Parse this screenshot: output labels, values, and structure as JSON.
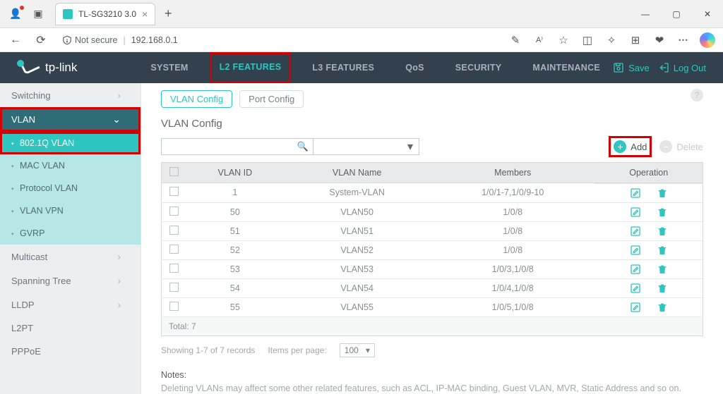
{
  "browser": {
    "tab_title": "TL-SG3210 3.0",
    "url": "192.168.0.1",
    "not_secure": "Not secure"
  },
  "header": {
    "brand": "tp-link",
    "nav": [
      "SYSTEM",
      "L2 FEATURES",
      "L3 FEATURES",
      "QoS",
      "SECURITY",
      "MAINTENANCE"
    ],
    "active_nav_index": 1,
    "save": "Save",
    "logout": "Log Out"
  },
  "sidebar": {
    "items": [
      {
        "label": "Switching",
        "type": "group"
      },
      {
        "label": "VLAN",
        "type": "group-expanded",
        "children": [
          "802.1Q VLAN",
          "MAC VLAN",
          "Protocol VLAN",
          "VLAN VPN",
          "GVRP"
        ],
        "active_child_index": 0
      },
      {
        "label": "Multicast",
        "type": "group"
      },
      {
        "label": "Spanning Tree",
        "type": "group"
      },
      {
        "label": "LLDP",
        "type": "group"
      },
      {
        "label": "L2PT",
        "type": "item"
      },
      {
        "label": "PPPoE",
        "type": "item"
      }
    ]
  },
  "content": {
    "tabs": [
      "VLAN Config",
      "Port Config"
    ],
    "active_tab_index": 0,
    "section_title": "VLAN Config",
    "add_label": "Add",
    "delete_label": "Delete",
    "columns": [
      "VLAN ID",
      "VLAN Name",
      "Members",
      "Operation"
    ],
    "rows": [
      {
        "id": "1",
        "name": "System-VLAN",
        "members": "1/0/1-7,1/0/9-10"
      },
      {
        "id": "50",
        "name": "VLAN50",
        "members": "1/0/8"
      },
      {
        "id": "51",
        "name": "VLAN51",
        "members": "1/0/8"
      },
      {
        "id": "52",
        "name": "VLAN52",
        "members": "1/0/8"
      },
      {
        "id": "53",
        "name": "VLAN53",
        "members": "1/0/3,1/0/8"
      },
      {
        "id": "54",
        "name": "VLAN54",
        "members": "1/0/4,1/0/8"
      },
      {
        "id": "55",
        "name": "VLAN55",
        "members": "1/0/5,1/0/8"
      }
    ],
    "total_label": "Total: 7",
    "showing_text": "Showing 1-7 of 7 records",
    "items_per_page_label": "Items per page:",
    "items_per_page_value": "100",
    "notes_title": "Notes:",
    "notes_text": "Deleting VLANs may affect some other related features, such as ACL, IP-MAC binding, Guest VLAN, MVR, Static Address and so on."
  }
}
